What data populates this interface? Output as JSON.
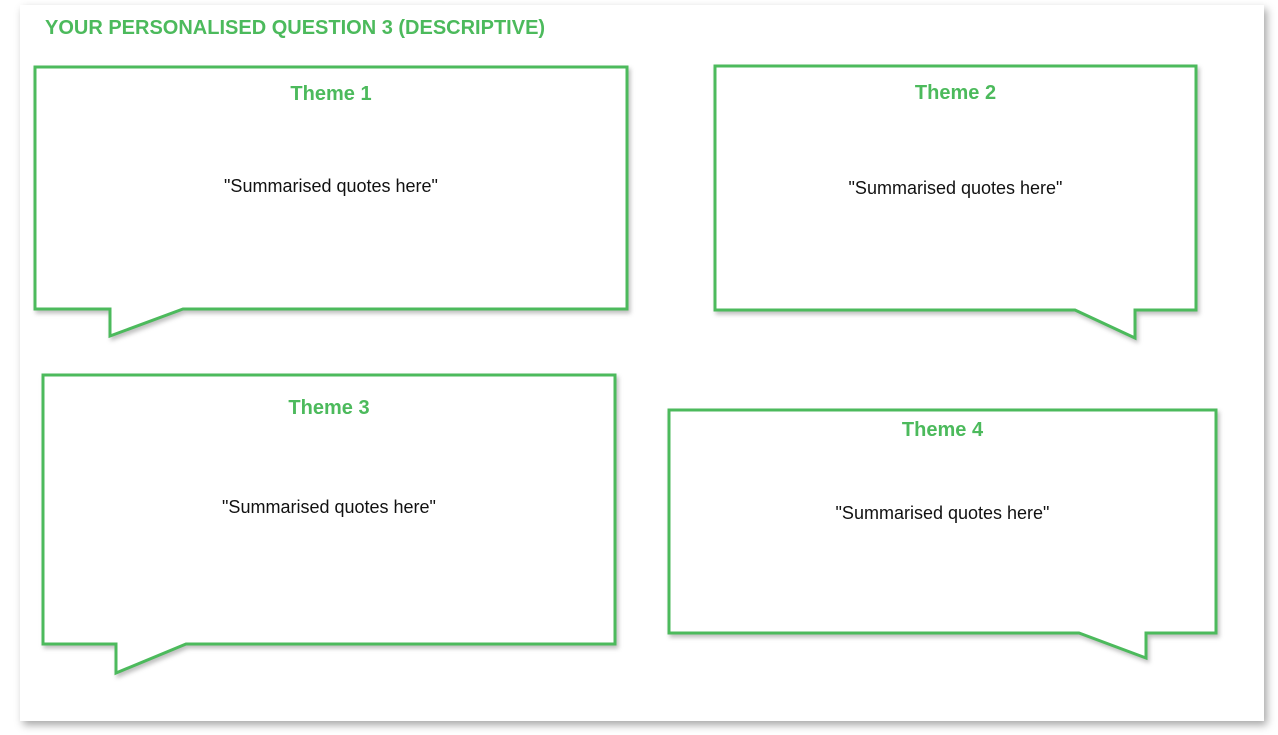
{
  "slide": {
    "title": "YOUR PERSONALISED QUESTION 3 (DESCRIPTIVE)",
    "accent_color": "#4cba5c"
  },
  "themes": [
    {
      "title": "Theme 1",
      "quote": "\"Summarised quotes here\""
    },
    {
      "title": "Theme 2",
      "quote": "\"Summarised quotes here\""
    },
    {
      "title": "Theme 3",
      "quote": "\"Summarised quotes here\""
    },
    {
      "title": "Theme 4",
      "quote": "\"Summarised quotes here\""
    }
  ]
}
